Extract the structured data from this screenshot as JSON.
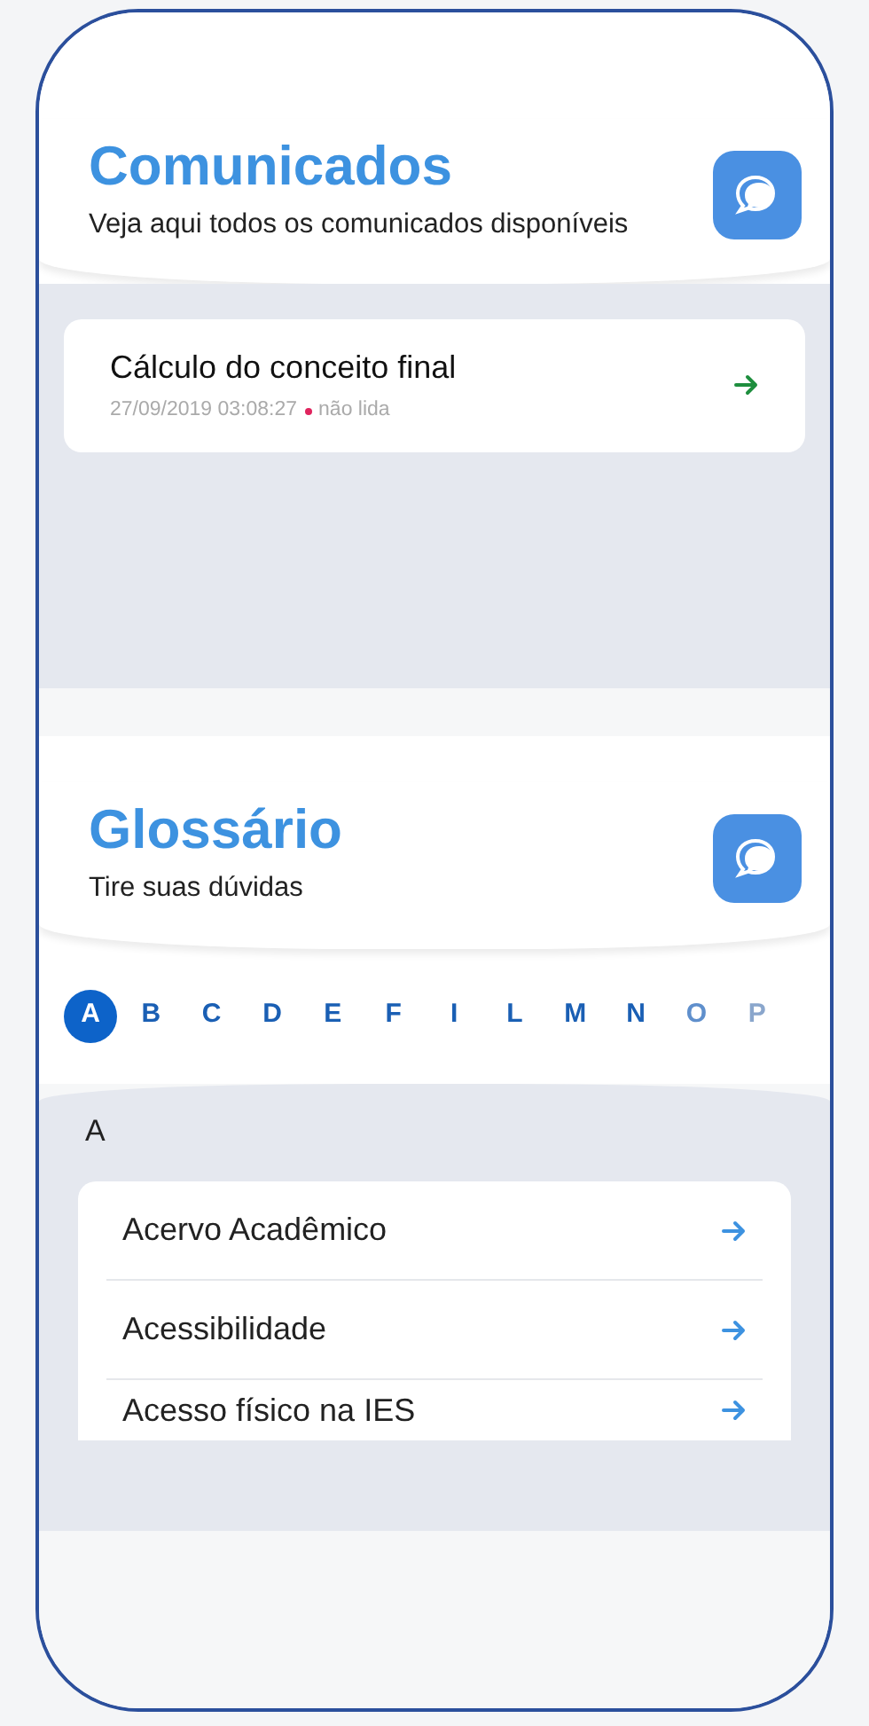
{
  "announcements": {
    "title": "Comunicados",
    "subtitle": "Veja aqui todos os comunicados disponíveis",
    "items": [
      {
        "title": "Cálculo do conceito final",
        "date": "27/09/2019 03:08:27",
        "status": "não lida",
        "read": false
      }
    ]
  },
  "glossary": {
    "title": "Glossário",
    "subtitle": "Tire suas dúvidas",
    "letters": [
      {
        "label": "A",
        "selected": true
      },
      {
        "label": "B",
        "selected": false
      },
      {
        "label": "C",
        "selected": false
      },
      {
        "label": "D",
        "selected": false
      },
      {
        "label": "E",
        "selected": false
      },
      {
        "label": "F",
        "selected": false
      },
      {
        "label": "I",
        "selected": false
      },
      {
        "label": "L",
        "selected": false
      },
      {
        "label": "M",
        "selected": false
      },
      {
        "label": "N",
        "selected": false
      },
      {
        "label": "O",
        "selected": false
      },
      {
        "label": "P",
        "selected": false
      }
    ],
    "section_heading": "A",
    "terms": [
      "Acervo Acadêmico",
      "Acessibilidade",
      "Acesso físico na IES"
    ]
  }
}
